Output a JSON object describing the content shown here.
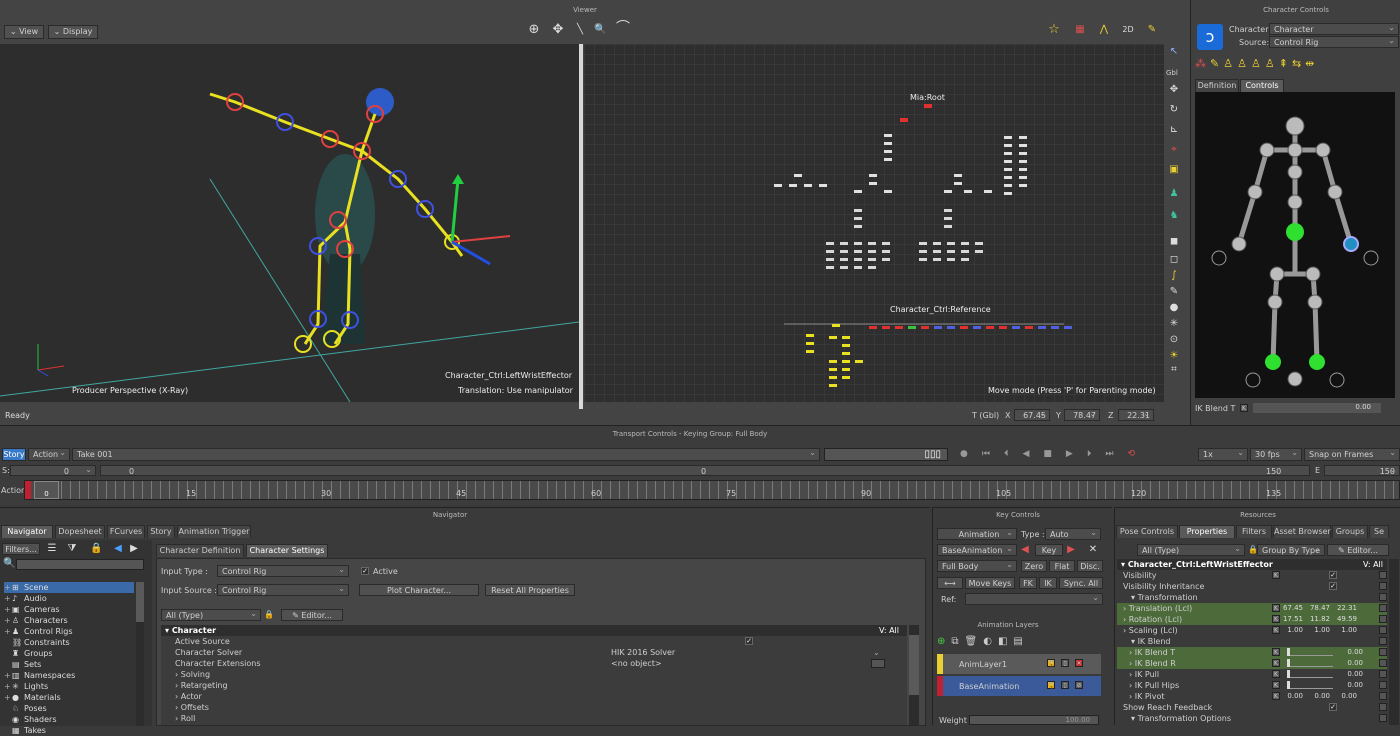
{
  "viewer": {
    "title": "Viewer",
    "view_btn": "View",
    "display_btn": "Display",
    "left_label": "Producer Perspective (X-Ray)",
    "effector_name": "Character_Ctrl:LeftWristEffector",
    "translation_hint": "Translation: Use manipulator",
    "mia_root": "Mia:Root",
    "ctrl_reference": "Character_Ctrl:Reference",
    "move_mode": "Move mode (Press 'P' for Parenting mode)",
    "status": "Ready",
    "tgbl": "T (Gbl)",
    "x_label": "X",
    "y_label": "Y",
    "z_label": "Z",
    "x_val": "67.45",
    "y_val": "78.47",
    "z_val": "22.31",
    "gbl_label": "Gbl"
  },
  "character_controls": {
    "title": "Character Controls",
    "character_label": "Character:",
    "character_value": "Character",
    "source_label": "Source:",
    "source_value": "Control Rig",
    "tab_definition": "Definition",
    "tab_controls": "Controls",
    "ik_blend_label": "IK Blend T",
    "ik_blend_value": "0.00"
  },
  "transport": {
    "title": "Transport Controls  -  Keying Group: Full Body",
    "story": "Story",
    "action": "Action",
    "take": "Take 001",
    "speed": "1x",
    "fps": "30 fps",
    "snap": "Snap on Frames",
    "s_label": "S:",
    "s_val": "0",
    "start_val": "0",
    "e_label": "E",
    "end_left": "150",
    "end_val": "150",
    "mid_tick": "0",
    "action_label": "Action",
    "ticks": [
      "15",
      "30",
      "45",
      "60",
      "75",
      "90",
      "105",
      "120",
      "135"
    ],
    "current_frame": "0"
  },
  "navigator": {
    "title": "Navigator",
    "tabs": [
      "Navigator",
      "Dopesheet",
      "FCurves",
      "Story",
      "Animation Trigger"
    ],
    "filters": "Filters...",
    "tree": [
      "Scene",
      "Audio",
      "Cameras",
      "Characters",
      "Control Rigs",
      "Constraints",
      "Groups",
      "Sets",
      "Namespaces",
      "Lights",
      "Materials",
      "Poses",
      "Shaders",
      "Takes"
    ],
    "subtabs": [
      "Character Definition",
      "Character Settings"
    ],
    "input_type_label": "Input Type :",
    "input_type_value": "Control Rig",
    "active_label": "Active",
    "input_source_label": "Input Source :",
    "input_source_value": "Control Rig",
    "plot_btn": "Plot Character...",
    "reset_btn": "Reset All Properties",
    "all_type": "All (Type)",
    "editor": "Editor...",
    "char_group": "Character",
    "v_all": "V: All",
    "rows": [
      "Active Source",
      "Character Solver",
      "Character Extensions",
      "Solving",
      "Retargeting",
      "Actor",
      "Offsets",
      "Roll"
    ],
    "solver_value": "HIK 2016 Solver",
    "ext_value": "<no object>"
  },
  "key_controls": {
    "title": "Key Controls",
    "animation_btn": "Animation",
    "type_label": "Type :",
    "type_value": "Auto",
    "base_anim": "BaseAnimation",
    "key_btn": "Key",
    "full_body": "Full Body",
    "zero_btn": "Zero",
    "flat_btn": "Flat",
    "disc_btn": "Disc.",
    "move_keys": "Move Keys",
    "fk": "FK",
    "ik": "IK",
    "sync": "Sync. All",
    "ref_label": "Ref:",
    "anim_layers_title": "Animation Layers",
    "layer1": "AnimLayer1",
    "layer2": "BaseAnimation",
    "weight_label": "Weight",
    "weight_value": "100.00"
  },
  "resources": {
    "title": "Resources",
    "tabs": [
      "Pose Controls",
      "Properties",
      "Filters",
      "Asset Browser",
      "Groups",
      "Se"
    ],
    "all_type": "All (Type)",
    "group_by": "Group By Type",
    "editor": "Editor...",
    "object": "Character_Ctrl:LeftWristEffector",
    "v_all": "V: All",
    "rows": [
      {
        "label": "Visibility",
        "k": true,
        "check": true
      },
      {
        "label": "Visibility Inheritance",
        "k": false,
        "check": true
      },
      {
        "label": "Transformation",
        "k": false,
        "group": true
      },
      {
        "label": "Translation (Lcl)",
        "k": true,
        "vals": [
          "67.45",
          "78.47",
          "22.31"
        ],
        "green": true
      },
      {
        "label": "Rotation (Lcl)",
        "k": true,
        "vals": [
          "17.51",
          "11.82",
          "49.59"
        ],
        "green": true
      },
      {
        "label": "Scaling (Lcl)",
        "k": true,
        "vals": [
          "1.00",
          "1.00",
          "1.00"
        ]
      },
      {
        "label": "IK Blend",
        "k": false,
        "group": true
      },
      {
        "label": "IK Blend T",
        "k": true,
        "slider": "0.00",
        "green": true
      },
      {
        "label": "IK Blend R",
        "k": true,
        "slider": "0.00",
        "green": true
      },
      {
        "label": "IK Pull",
        "k": true,
        "slider": "0.00"
      },
      {
        "label": "IK Pull Hips",
        "k": true,
        "slider": "0.00"
      },
      {
        "label": "IK Pivot",
        "k": true,
        "vals": [
          "0.00",
          "0.00",
          "0.00"
        ]
      },
      {
        "label": "Show Reach Feedback",
        "k": false,
        "check": true
      },
      {
        "label": "Transformation Options",
        "k": false,
        "group": true
      }
    ]
  }
}
